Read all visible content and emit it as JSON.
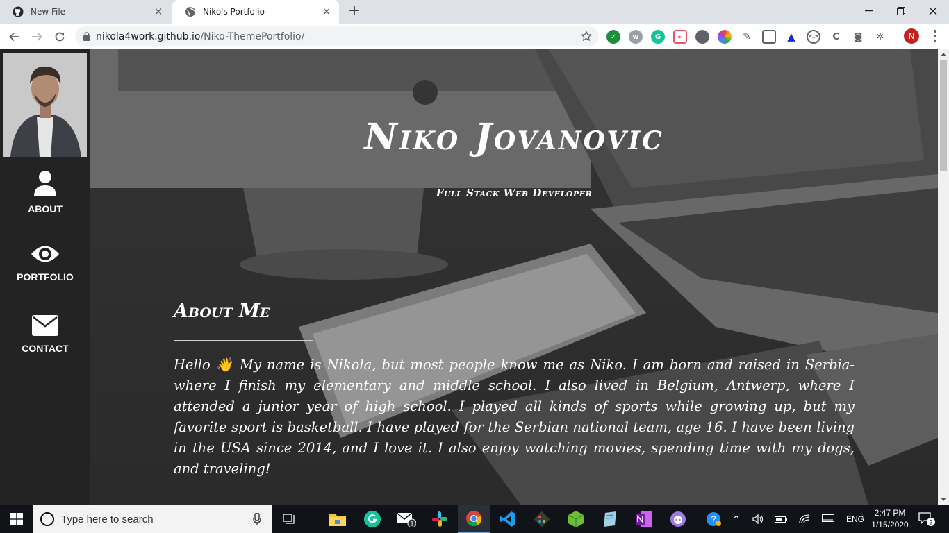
{
  "browser": {
    "tabs": [
      {
        "title": "New File",
        "active": false,
        "icon": "github-icon"
      },
      {
        "title": "Niko's Portfolio",
        "active": true,
        "icon": "globe-icon"
      }
    ],
    "url_host": "nikola4work.github.io",
    "url_path": "/Niko-ThemePortfolio/",
    "profile_initial": "N"
  },
  "sidebar": {
    "items": [
      {
        "label": "ABOUT",
        "icon": "user-icon"
      },
      {
        "label": "PORTFOLIO",
        "icon": "eye-icon"
      },
      {
        "label": "CONTACT",
        "icon": "envelope-icon"
      }
    ]
  },
  "hero": {
    "name": "Niko Jovanovic",
    "role": "Full Stack Web Developer"
  },
  "about": {
    "title": "About Me",
    "text": "Hello 👋 My name is Nikola, but most people know me as Niko. I am born and raised in Serbia-where I finish my elementary and middle school. I also lived in Belgium, Antwerp, where I attended a junior year of high school. I played all kinds of sports while growing up, but my favorite sport is basketball. I have played for the Serbian national team, age 16. I have been living in the USA since 2014, and I love it. I also enjoy watching movies, spending time with my dogs, and traveling!"
  },
  "taskbar": {
    "search_placeholder": "Type here to search",
    "language": "ENG",
    "time": "2:47 PM",
    "date": "1/15/2020",
    "notifications": "3",
    "mail_badge": "1"
  },
  "colors": {
    "sidebar": "#232323",
    "text": "#ffffff",
    "taskbar": "#101418"
  }
}
